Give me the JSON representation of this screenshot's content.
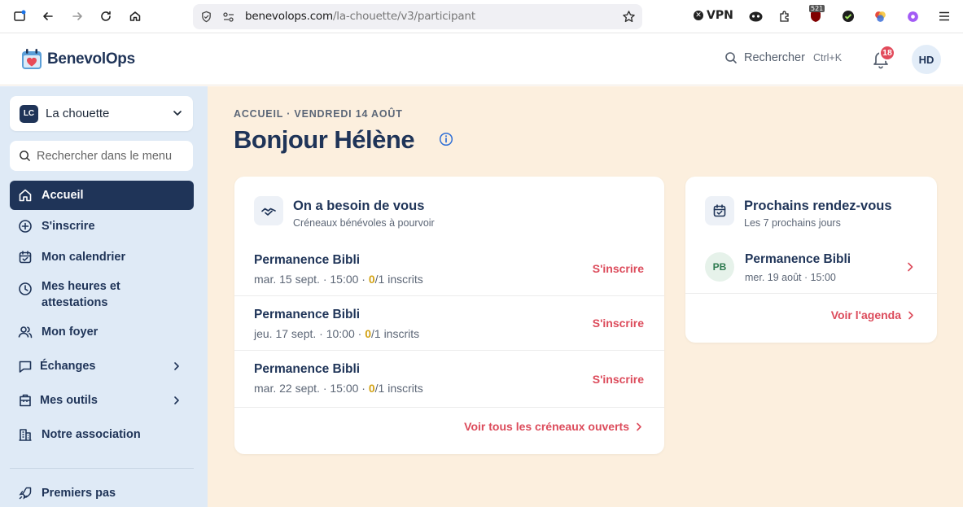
{
  "browser": {
    "url_domain": "benevolops.com",
    "url_path": "/la-chouette/v3/participant",
    "vpn_label": "VPN",
    "ext_badge": "521"
  },
  "header": {
    "app_name": "BenevolOps",
    "search_label": "Rechercher",
    "search_shortcut": "Ctrl+K",
    "notif_count": "18",
    "user_initials": "HD"
  },
  "sidebar": {
    "org_initials": "LC",
    "org_name": "La chouette",
    "search_placeholder": "Rechercher dans le menu",
    "items": [
      {
        "label": "Accueil",
        "icon": "home-icon"
      },
      {
        "label": "S'inscrire",
        "icon": "plus-circle-icon"
      },
      {
        "label": "Mon calendrier",
        "icon": "calendar-check-icon"
      },
      {
        "label": "Mes heures et attestations",
        "icon": "clock-icon"
      },
      {
        "label": "Mon foyer",
        "icon": "users-icon"
      },
      {
        "label": "Échanges",
        "icon": "chat-icon"
      },
      {
        "label": "Mes outils",
        "icon": "toolbox-icon"
      },
      {
        "label": "Notre association",
        "icon": "building-icon"
      },
      {
        "label": "Premiers pas",
        "icon": "rocket-icon"
      }
    ]
  },
  "main": {
    "breadcrumb": "ACCUEIL · VENDREDI 14 AOÛT",
    "greeting": "Bonjour Hélène",
    "needs": {
      "title": "On a besoin de vous",
      "subtitle": "Créneaux bénévoles à pourvoir",
      "shifts": [
        {
          "name": "Permanence Bibli",
          "date": "mar. 15 sept. · 15:00 · ",
          "count": "0",
          "capacity": "/1 inscrits",
          "cta": "S'inscrire"
        },
        {
          "name": "Permanence Bibli",
          "date": "jeu. 17 sept. · 10:00 · ",
          "count": "0",
          "capacity": "/1 inscrits",
          "cta": "S'inscrire"
        },
        {
          "name": "Permanence Bibli",
          "date": "mar. 22 sept. · 15:00 · ",
          "count": "0",
          "capacity": "/1 inscrits",
          "cta": "S'inscrire"
        }
      ],
      "link": "Voir tous les créneaux ouverts"
    },
    "upcoming": {
      "title": "Prochains rendez-vous",
      "subtitle": "Les 7 prochains jours",
      "items": [
        {
          "initials": "PB",
          "name": "Permanence Bibli",
          "meta": "mer. 19 août · 15:00"
        }
      ],
      "link": "Voir l'agenda"
    }
  },
  "colors": {
    "brand_navy": "#1f3458",
    "accent_red": "#dc4b5b",
    "sidebar_bg": "#dfeaf6",
    "main_bg": "#fcefde",
    "count_yellow": "#d3a316"
  }
}
